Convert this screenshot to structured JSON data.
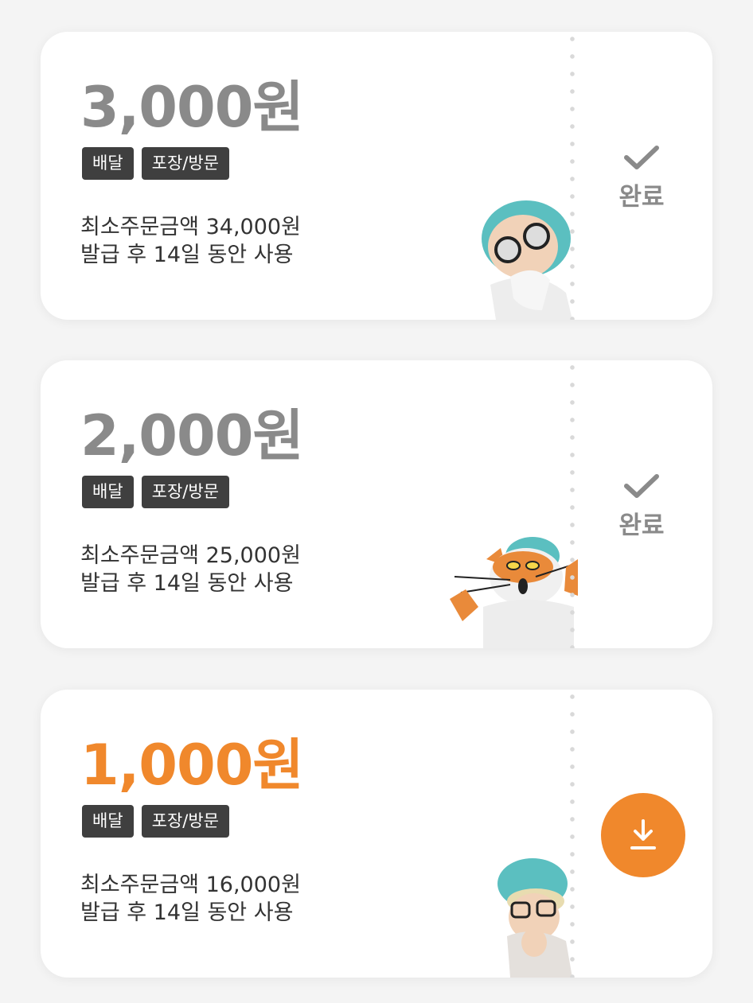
{
  "coupons": [
    {
      "amount": "3,000원",
      "tags": [
        "배달",
        "포장/방문"
      ],
      "min_order": "최소주문금액 34,000원",
      "validity": "발급 후 14일 동안 사용",
      "status": "done",
      "status_label": "완료",
      "mascot": "nurse-with-goggles-mascot"
    },
    {
      "amount": "2,000원",
      "tags": [
        "배달",
        "포장/방문"
      ],
      "min_order": "최소주문금액 25,000원",
      "validity": "발급 후 14일 동안 사용",
      "status": "done",
      "status_label": "완료",
      "mascot": "orange-cat-mascot"
    },
    {
      "amount": "1,000원",
      "tags": [
        "배달",
        "포장/방문"
      ],
      "min_order": "최소주문금액 16,000원",
      "validity": "발급 후 14일 동안 사용",
      "status": "download",
      "mascot": "elderly-mascot-with-glasses"
    }
  ],
  "colors": {
    "accent": "#f0882c",
    "inactive_amount": "#8a8a8a",
    "tag_background": "#3f3f3f",
    "card_background": "#ffffff",
    "page_background": "#f4f4f4"
  }
}
